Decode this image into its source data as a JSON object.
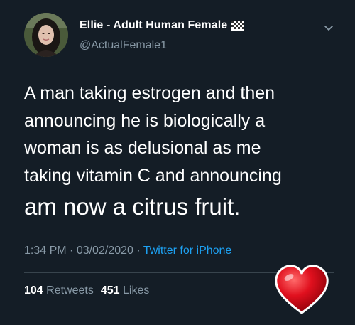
{
  "header": {
    "display_name": "Ellie - Adult Human Female",
    "handle": "@ActualFemale1",
    "flag_icon": "checkered-flag-icon",
    "menu_icon": "chevron-down-icon"
  },
  "tweet": {
    "lines": [
      "A man taking estrogen and then",
      "announcing he is biologically a",
      "woman is as delusional as me",
      "taking vitamin C and announcing",
      "am now a citrus fruit."
    ]
  },
  "meta": {
    "time": "1:34 PM",
    "separator": " · ",
    "date": "03/02/2020",
    "source": "Twitter for iPhone"
  },
  "stats": {
    "retweets_count": "104",
    "retweets_label": "Retweets",
    "likes_count": "451",
    "likes_label": "Likes"
  },
  "colors": {
    "background": "#141d26",
    "secondary_text": "#8899a6",
    "link": "#1da1f2",
    "heart": "#e0101e"
  },
  "sticker": {
    "icon": "red-heart-icon"
  }
}
